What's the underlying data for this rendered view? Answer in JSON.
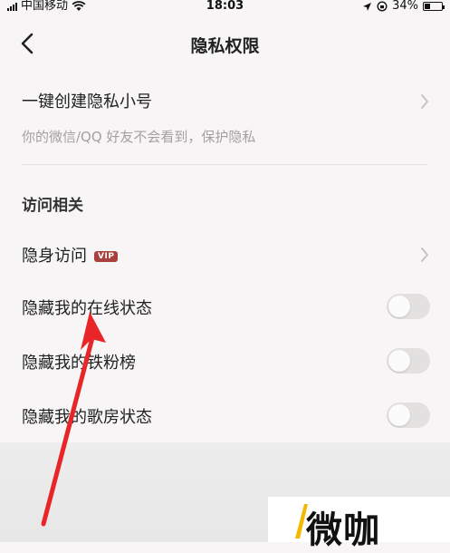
{
  "status_bar": {
    "carrier": "中国移动",
    "time": "18:03",
    "battery": "34%",
    "battery_level": 0.34
  },
  "header": {
    "title": "隐私权限"
  },
  "private_account": {
    "label": "一键创建隐私小号",
    "description": "你的微信/QQ 好友不会看到，保护隐私"
  },
  "visit_section": {
    "title": "访问相关",
    "items": [
      {
        "label": "隐身访问",
        "badge": "VIP",
        "type": "link"
      },
      {
        "label": "隐藏我的在线状态",
        "type": "toggle",
        "on": false
      },
      {
        "label": "隐藏我的铁粉榜",
        "type": "toggle",
        "on": false
      },
      {
        "label": "隐藏我的歌房状态",
        "type": "toggle",
        "on": false
      }
    ]
  },
  "watermark": {
    "text": "微咖"
  },
  "colors": {
    "background": "#f7f5f5",
    "annotation_arrow": "#e8262a",
    "vip_badge": "#a8403e",
    "watermark_accent": "#f5b800"
  }
}
